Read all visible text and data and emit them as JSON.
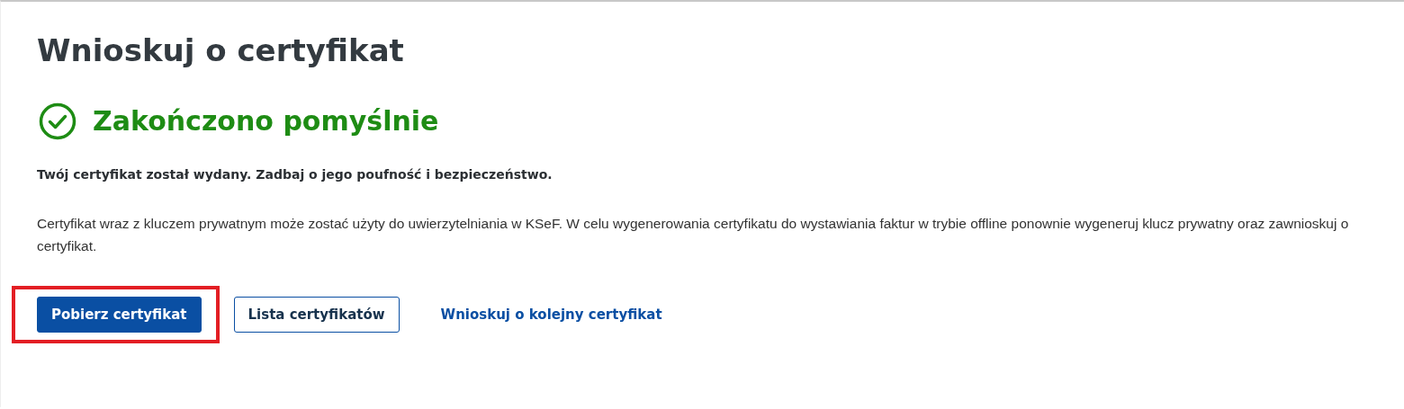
{
  "page": {
    "title": "Wnioskuj o certyfikat"
  },
  "status": {
    "kind": "success",
    "heading": "Zakończono pomyślnie"
  },
  "notice": "Twój certyfikat został wydany. Zadbaj o jego poufność i bezpieczeństwo.",
  "description": "Certyfikat wraz z kluczem prywatnym może zostać użyty do uwierzytelniania w KSeF. W celu wygenerowania certyfikatu do wystawiania faktur w trybie offline ponownie wygeneruj klucz prywatny oraz zawnioskuj o certyfikat.",
  "actions": [
    {
      "kind": "primary",
      "label": "Pobierz certyfikat",
      "highlighted": true
    },
    {
      "kind": "outline",
      "label": "Lista certyfikatów",
      "highlighted": false
    },
    {
      "kind": "link",
      "label": "Wnioskuj o kolejny certyfikat",
      "highlighted": false
    }
  ]
}
